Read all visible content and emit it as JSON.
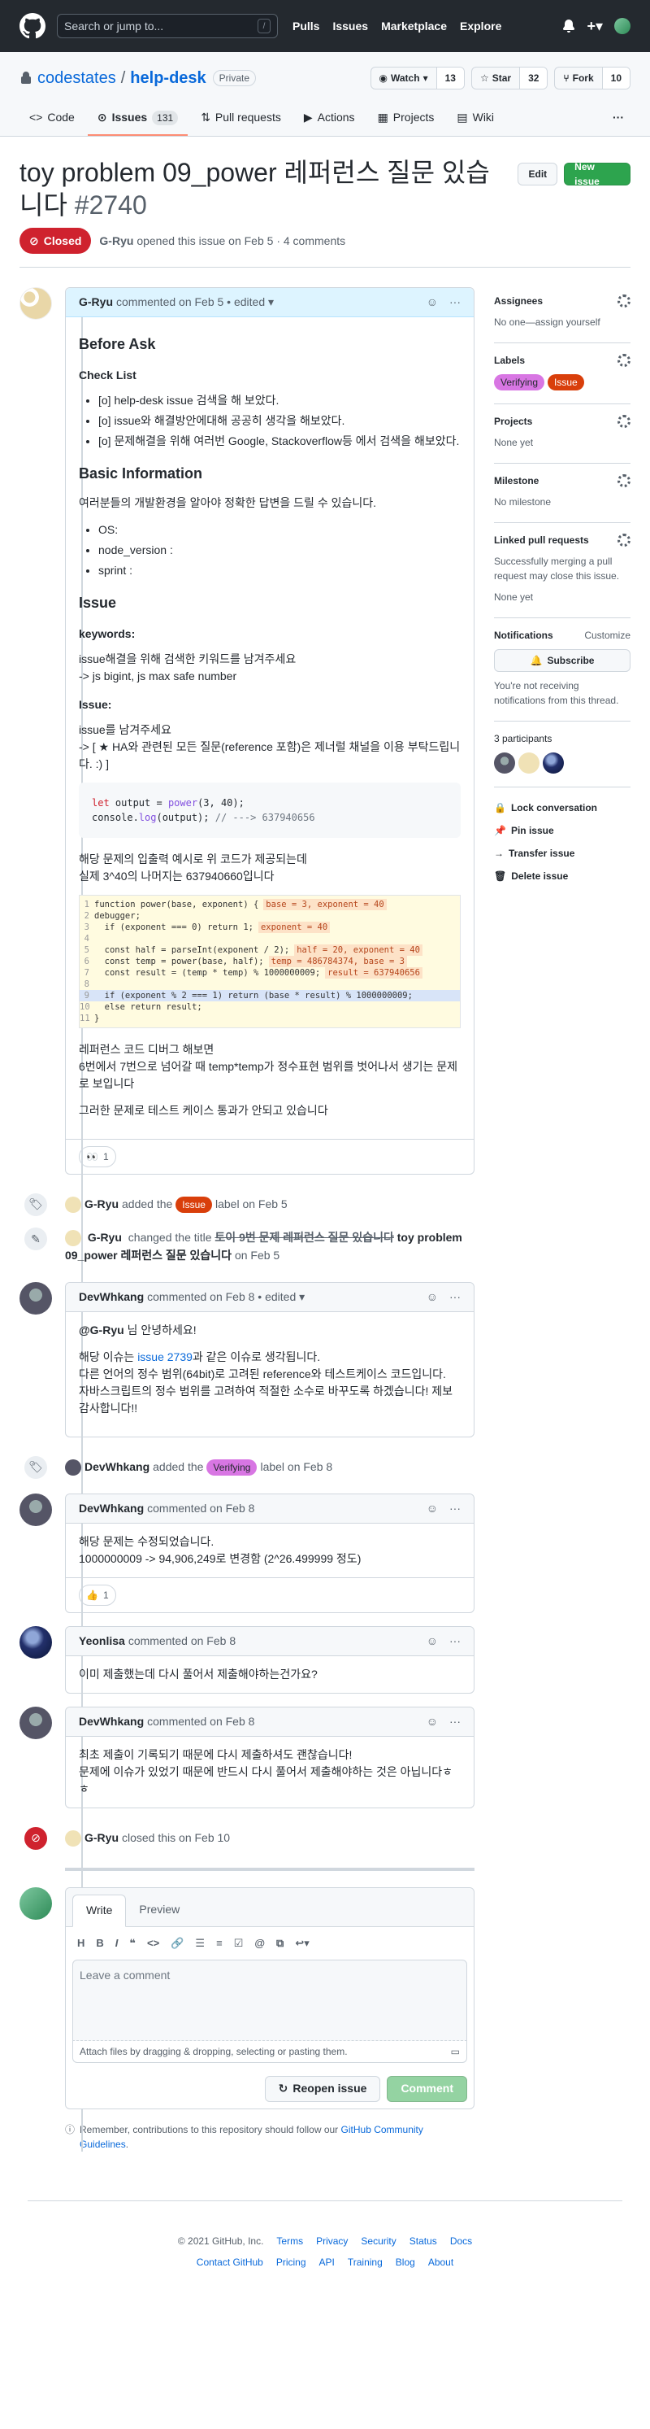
{
  "topbar": {
    "search_placeholder": "Search or jump to...",
    "search_key": "/",
    "nav": [
      "Pulls",
      "Issues",
      "Marketplace",
      "Explore"
    ]
  },
  "repo": {
    "owner": "codestates",
    "sep": "/",
    "name": "help-desk",
    "visibility": "Private",
    "watch_label": "Watch",
    "watch_count": "13",
    "star_label": "Star",
    "star_count": "32",
    "fork_label": "Fork",
    "fork_count": "10",
    "tabs": [
      {
        "label": "Code"
      },
      {
        "label": "Issues",
        "count": "131"
      },
      {
        "label": "Pull requests"
      },
      {
        "label": "Actions"
      },
      {
        "label": "Projects"
      },
      {
        "label": "Wiki"
      }
    ]
  },
  "issue": {
    "title": "toy problem 09_power 레퍼런스 질문 있습니다",
    "number": "#2740",
    "edit_label": "Edit",
    "new_issue_label": "New issue",
    "state": "Closed",
    "author": "G-Ryu",
    "meta": "opened this issue on Feb 5 · 4 comments"
  },
  "first_comment": {
    "author": "G-Ryu",
    "meta": "commented on Feb 5 • edited",
    "h_before": "Before Ask",
    "h_checklist": "Check List",
    "checklist": [
      "[o] help-desk issue 검색을 해 보았다.",
      "[o] issue와 해결방안에대해 공공히 생각을 해보았다.",
      "[o] 문제해결을 위해 여러번 Google, Stackoverflow등 에서 검색을 해보았다."
    ],
    "h_basic": "Basic Information",
    "basic_intro": "여러분들의 개발환경을 알아야 정확한 답변을 드릴 수 있습니다.",
    "basic_list": [
      "OS:",
      "node_version :",
      "sprint :"
    ],
    "h_issue": "Issue",
    "h_keywords": "keywords:",
    "keywords_line1": "issue해결을 위해 검색한 키워드를 남겨주세요",
    "keywords_line2": "-> js bigint, js max safe number",
    "h_issue2": "Issue:",
    "issue_line1": "issue를 남겨주세요",
    "issue_line2": "-> [ ★ HA와 관련된 모든 질문(reference 포함)은 제너럴 채널을 이용 부탁드립니다. :) ]",
    "code_line1_a": "let",
    "code_line1_b": " output = ",
    "code_line1_c": "power",
    "code_line1_d": "(3, 40);",
    "code_line2_a": "console.",
    "code_line2_b": "log",
    "code_line2_c": "(output); ",
    "code_line2_d": "// ---> 637940656",
    "after_code1": "해당 문제의 입출력 예시로 위 코드가 제공되는데",
    "after_code2": "실제 3^40의 나머지는 637940660입니다",
    "debug_lines": [
      {
        "no": "1",
        "text": "function power(base, exponent) {",
        "hint": "base = 3, exponent = 40"
      },
      {
        "no": "2",
        "text": "debugger;",
        "hint": ""
      },
      {
        "no": "3",
        "text": "  if (exponent === 0) return 1;",
        "hint": "exponent = 40"
      },
      {
        "no": "4",
        "text": "",
        "hint": ""
      },
      {
        "no": "5",
        "text": "  const half = parseInt(exponent / 2);",
        "hint": "half = 20, exponent = 40"
      },
      {
        "no": "6",
        "text": "  const temp = power(base, half);",
        "hint": "temp = 486784374, base = 3"
      },
      {
        "no": "7",
        "text": "  const result = (temp * temp) % 1000000009;",
        "hint": "result = 637940656"
      },
      {
        "no": "8",
        "text": "",
        "hint": ""
      },
      {
        "no": "9",
        "text": "  if (exponent % 2 === 1) return (base * result) % 1000000009;",
        "hint": ""
      },
      {
        "no": "10",
        "text": "  else return result;",
        "hint": ""
      },
      {
        "no": "11",
        "text": "}",
        "hint": ""
      }
    ],
    "after_img1": "레퍼런스 코드 디버그 해보면",
    "after_img2": "6번에서 7번으로 넘어갈 때 temp*temp가 정수표현 범위를 벗어나서 생기는 문제로 보입니다",
    "after_img3": "그러한 문제로 테스트 케이스 통과가 안되고 있습니다",
    "reaction_emoji": "👀",
    "reaction_count": "1"
  },
  "events": {
    "label1_author": "G-Ryu",
    "label1_pre": "added the",
    "label1_name": "Issue",
    "label1_post": "label on Feb 5",
    "rename_author": "G-Ryu",
    "rename_pre": "changed the title",
    "rename_old": "토이 9번 문제 레퍼런스 질문 있습니다",
    "rename_new": "toy problem 09_power 레퍼런스 질문 있습니다",
    "rename_post": "on Feb 5",
    "label2_author": "DevWhkang",
    "label2_pre": "added the",
    "label2_name": "Verifying",
    "label2_post": "label on Feb 8",
    "closed_author": "G-Ryu",
    "closed_text": "closed this on Feb 10"
  },
  "comments": [
    {
      "author": "DevWhkang",
      "meta": "commented on Feb 8 • edited",
      "mention": "@G-Ryu",
      "line1": " 님 안녕하세요!",
      "line2_pre": "해당 이슈는 ",
      "line2_link": "issue 2739",
      "line2_post": "과 같은 이슈로 생각됩니다.",
      "line3": "다른 언어의 정수 범위(64bit)로 고려된 reference와 테스트케이스 코드입니다.",
      "line4": "자바스크립트의 정수 범위를 고려하여 적절한 소수로 바꾸도록 하겠습니다! 제보 감사합니다!!"
    },
    {
      "author": "DevWhkang",
      "meta": "commented on Feb 8",
      "line1": "해당 문제는 수정되었습니다.",
      "line2": "1000000009 -> 94,906,249로 변경함 (2^26.499999 정도)",
      "reaction_emoji": "👍",
      "reaction_count": "1"
    },
    {
      "author": "Yeonlisa",
      "meta": "commented on Feb 8",
      "line1": "이미 제출했는데 다시 풀어서 제출해야하는건가요?"
    },
    {
      "author": "DevWhkang",
      "meta": "commented on Feb 8",
      "line1": "최초 제출이 기록되기 때문에 다시 제출하셔도 괜찮습니다!",
      "line2": "문제에 이슈가 있었기 때문에 반드시 다시 풀어서 제출해야하는 것은 아닙니다ㅎㅎ"
    }
  ],
  "sidebar": {
    "assignees_title": "Assignees",
    "assignees_value": "No one—assign yourself",
    "labels_title": "Labels",
    "labels": [
      {
        "name": "Verifying",
        "color": "#d876e3"
      },
      {
        "name": "Issue",
        "color": "#d93f0b"
      }
    ],
    "projects_title": "Projects",
    "projects_value": "None yet",
    "milestone_title": "Milestone",
    "milestone_value": "No milestone",
    "linked_title": "Linked pull requests",
    "linked_desc": "Successfully merging a pull request may close this issue.",
    "linked_value": "None yet",
    "notif_title": "Notifications",
    "notif_customize": "Customize",
    "subscribe": "Subscribe",
    "notif_desc": "You're not receiving notifications from this thread.",
    "participants_title": "3 participants",
    "lock": "Lock conversation",
    "pin": "Pin issue",
    "transfer": "Transfer issue",
    "delete": "Delete issue"
  },
  "editor": {
    "tab_write": "Write",
    "tab_preview": "Preview",
    "toolbar": [
      "H",
      "B",
      "I"
    ],
    "placeholder": "Leave a comment",
    "attach": "Attach files by dragging & dropping, selecting or pasting them.",
    "reopen": "Reopen issue",
    "comment": "Comment",
    "remember_pre": "Remember, contributions to this repository should follow our ",
    "remember_link": "GitHub Community Guidelines",
    "remember_post": "."
  },
  "footer": {
    "copyright": "© 2021 GitHub, Inc.",
    "row1": [
      "Terms",
      "Privacy",
      "Security",
      "Status",
      "Docs"
    ],
    "row2": [
      "Contact GitHub",
      "Pricing",
      "API",
      "Training",
      "Blog",
      "About"
    ]
  }
}
